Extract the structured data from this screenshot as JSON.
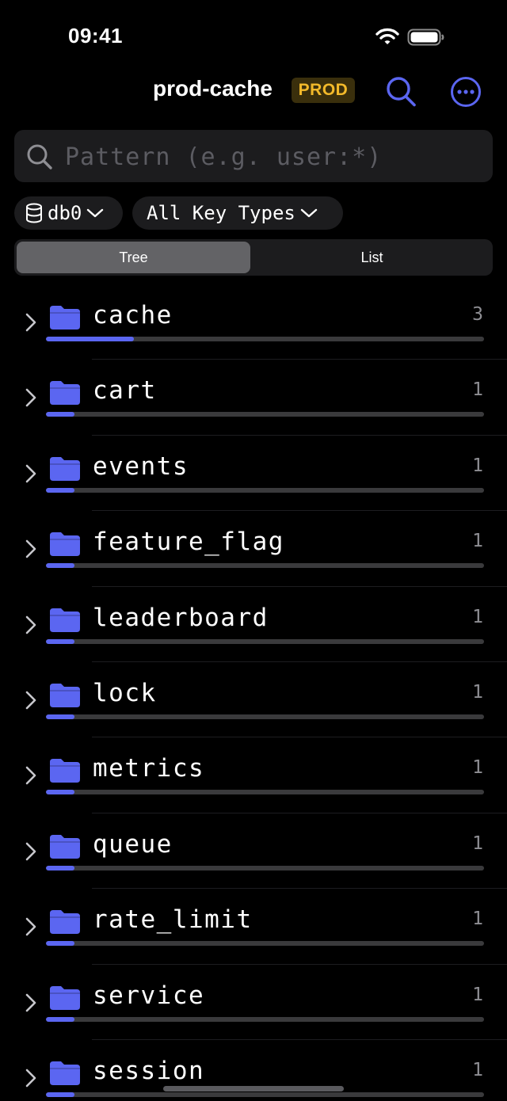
{
  "status_bar": {
    "time": "09:41"
  },
  "header": {
    "title": "prod-cache",
    "env_badge": "PROD"
  },
  "search": {
    "placeholder": "Pattern (e.g. user:*)",
    "value": ""
  },
  "filters": {
    "database": "db0",
    "key_type": "All Key Types"
  },
  "view_mode": {
    "options": [
      "Tree",
      "List"
    ],
    "selected": "Tree"
  },
  "colors": {
    "accent": "#5b66f1",
    "badge_text": "#f2b92a",
    "badge_bg": "#3a2f0c"
  },
  "tree": [
    {
      "name": "cache",
      "count": "3",
      "share": 0.2
    },
    {
      "name": "cart",
      "count": "1",
      "share": 0.066
    },
    {
      "name": "events",
      "count": "1",
      "share": 0.066
    },
    {
      "name": "feature_flag",
      "count": "1",
      "share": 0.066
    },
    {
      "name": "leaderboard",
      "count": "1",
      "share": 0.066
    },
    {
      "name": "lock",
      "count": "1",
      "share": 0.066
    },
    {
      "name": "metrics",
      "count": "1",
      "share": 0.066
    },
    {
      "name": "queue",
      "count": "1",
      "share": 0.066
    },
    {
      "name": "rate_limit",
      "count": "1",
      "share": 0.066
    },
    {
      "name": "service",
      "count": "1",
      "share": 0.066
    },
    {
      "name": "session",
      "count": "1",
      "share": 0.066
    }
  ]
}
